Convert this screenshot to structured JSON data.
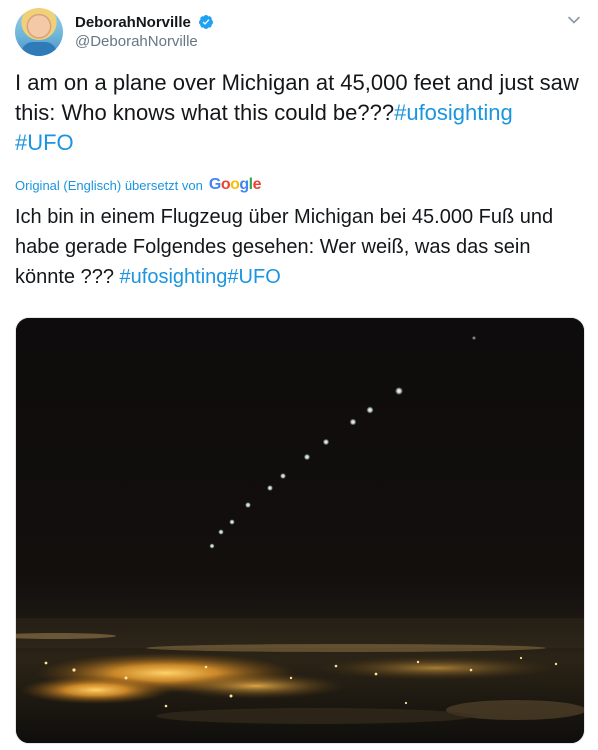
{
  "author": {
    "display_name": "DeborahNorville",
    "handle": "@DeborahNorville",
    "verified": true,
    "avatar_icon": "profile-photo"
  },
  "tweet": {
    "text_main": "I am on a plane over Michigan at 45,000 feet and just saw this:  Who knows what this could be???",
    "hashtag_1": "#ufosighting",
    "hashtag_2": "#UFO"
  },
  "translation": {
    "label": "Original (Englisch) übersetzt von",
    "provider": "Google",
    "text_main": "Ich bin in einem Flugzeug über Michigan bei 45.000 Fuß und habe gerade Folgendes gesehen: Wer weiß, was das sein könnte ??? ",
    "hashtag_1": "#ufosighting",
    "hashtag_2": "#UFO"
  },
  "media": {
    "type": "photo",
    "subject": "night-sky-lights-over-city"
  },
  "colors": {
    "link": "#1b95e0",
    "verified": "#1da1f2",
    "text": "#14171a",
    "secondary": "#657786"
  }
}
